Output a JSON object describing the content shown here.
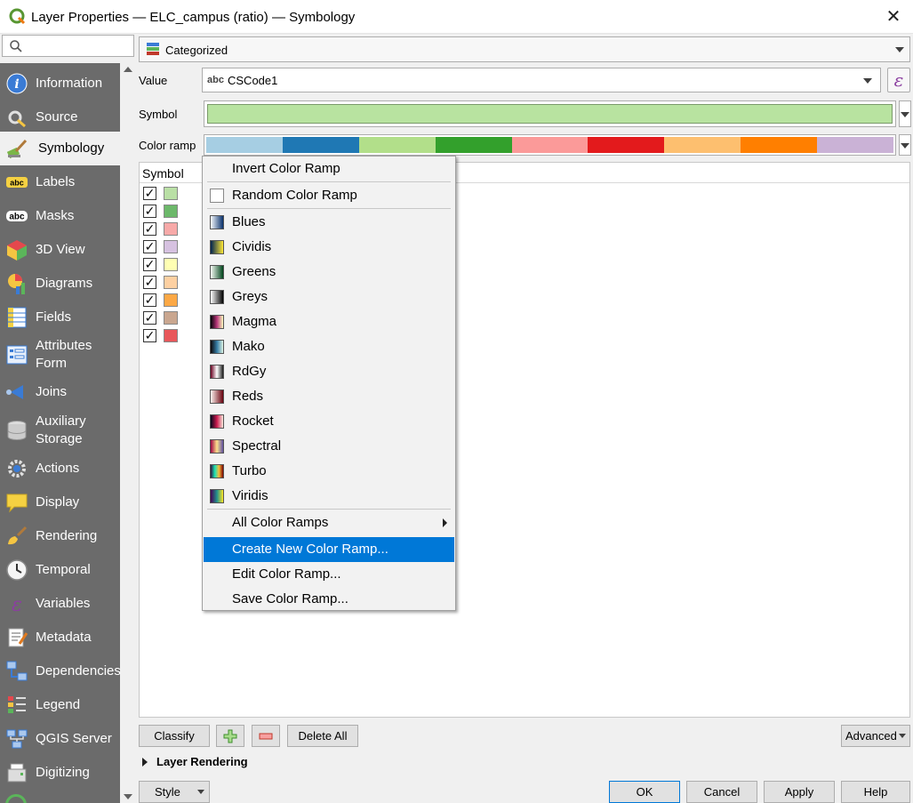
{
  "window": {
    "title": "Layer Properties — ELC_campus (ratio) — Symbology"
  },
  "search": {
    "placeholder": ""
  },
  "sidebar": {
    "items": [
      {
        "label": "Information",
        "icon": "info-icon"
      },
      {
        "label": "Source",
        "icon": "source-wrench-icon"
      },
      {
        "label": "Symbology",
        "icon": "paintbrush-icon",
        "active": true
      },
      {
        "label": "Labels",
        "icon": "labels-abc-icon"
      },
      {
        "label": "Masks",
        "icon": "masks-abc-icon"
      },
      {
        "label": "3D View",
        "icon": "cube-icon"
      },
      {
        "label": "Diagrams",
        "icon": "diagrams-icon"
      },
      {
        "label": "Fields",
        "icon": "fields-icon"
      },
      {
        "label": "Attributes Form",
        "icon": "attributes-form-icon"
      },
      {
        "label": "Joins",
        "icon": "joins-icon"
      },
      {
        "label": "Auxiliary Storage",
        "icon": "database-icon"
      },
      {
        "label": "Actions",
        "icon": "actions-gear-icon"
      },
      {
        "label": "Display",
        "icon": "speech-bubble-icon"
      },
      {
        "label": "Rendering",
        "icon": "brush-icon"
      },
      {
        "label": "Temporal",
        "icon": "clock-icon"
      },
      {
        "label": "Variables",
        "icon": "epsilon-icon"
      },
      {
        "label": "Metadata",
        "icon": "metadata-icon"
      },
      {
        "label": "Dependencies",
        "icon": "dependencies-icon"
      },
      {
        "label": "Legend",
        "icon": "legend-icon"
      },
      {
        "label": "QGIS Server",
        "icon": "server-icon"
      },
      {
        "label": "Digitizing",
        "icon": "digitizing-icon"
      }
    ]
  },
  "renderer": {
    "selected": "Categorized",
    "icon": "categorized-icon"
  },
  "form": {
    "value_label": "Value",
    "value_type": "abc",
    "value_field": "CSCode1",
    "symbol_label": "Symbol",
    "color_ramp_label": "Color ramp"
  },
  "colors": {
    "symbol_fill": "#b8e3a0",
    "ramp": [
      "#a6cee3",
      "#1f78b4",
      "#b2df8a",
      "#33a02c",
      "#fb9a99",
      "#e31a1c",
      "#fdbf6f",
      "#ff7f00",
      "#cab2d6"
    ],
    "highlight": "#0078d7"
  },
  "table": {
    "header": "Symbol",
    "rows": [
      {
        "checked": "✓",
        "color": "#b9dfa5"
      },
      {
        "checked": "✓",
        "color": "#6cb86a"
      },
      {
        "checked": "✓",
        "color": "#f7a9a8"
      },
      {
        "checked": "✓",
        "color": "#d6c1e0"
      },
      {
        "checked": "✓",
        "color": "#ffffb3"
      },
      {
        "checked": "✓",
        "color": "#fdd0a2"
      },
      {
        "checked": "✓",
        "color": "#fca845"
      },
      {
        "checked": "✓",
        "color": "#c9a68f"
      },
      {
        "checked": "✓",
        "color": "#e8575a"
      }
    ]
  },
  "menu": {
    "invert": "Invert Color Ramp",
    "random": "Random Color Ramp",
    "ramps": [
      {
        "label": "Blues",
        "gradient": [
          "#f7fbff",
          "#08306b"
        ]
      },
      {
        "label": "Cividis",
        "gradient": [
          "#00224e",
          "#fee838"
        ]
      },
      {
        "label": "Greens",
        "gradient": [
          "#f7fcf5",
          "#00441b"
        ]
      },
      {
        "label": "Greys",
        "gradient": [
          "#ffffff",
          "#000000"
        ]
      },
      {
        "label": "Magma",
        "gradient": [
          "#000004",
          "#b63679",
          "#fcfdbf"
        ]
      },
      {
        "label": "Mako",
        "gradient": [
          "#0b0405",
          "#357ba3",
          "#def5e5"
        ]
      },
      {
        "label": "RdGy",
        "gradient": [
          "#67001f",
          "#ffffff",
          "#1a1a1a"
        ]
      },
      {
        "label": "Reds",
        "gradient": [
          "#fff5f0",
          "#67000d"
        ]
      },
      {
        "label": "Rocket",
        "gradient": [
          "#03051a",
          "#cb1b4f",
          "#faebdd"
        ]
      },
      {
        "label": "Spectral",
        "gradient": [
          "#9e0142",
          "#fee08b",
          "#5e4fa2"
        ]
      },
      {
        "label": "Turbo",
        "gradient": [
          "#30123b",
          "#1ae4b6",
          "#fabb39",
          "#7a0403"
        ]
      },
      {
        "label": "Viridis",
        "gradient": [
          "#440154",
          "#21908d",
          "#fde725"
        ]
      }
    ],
    "all_ramps": "All Color Ramps",
    "create": "Create New Color Ramp...",
    "edit": "Edit Color Ramp...",
    "save": "Save Color Ramp..."
  },
  "bottom": {
    "classify": "Classify",
    "delete_all": "Delete All",
    "advanced": "Advanced",
    "layer_rendering": "Layer Rendering",
    "style": "Style",
    "ok": "OK",
    "cancel": "Cancel",
    "apply": "Apply",
    "help": "Help"
  }
}
